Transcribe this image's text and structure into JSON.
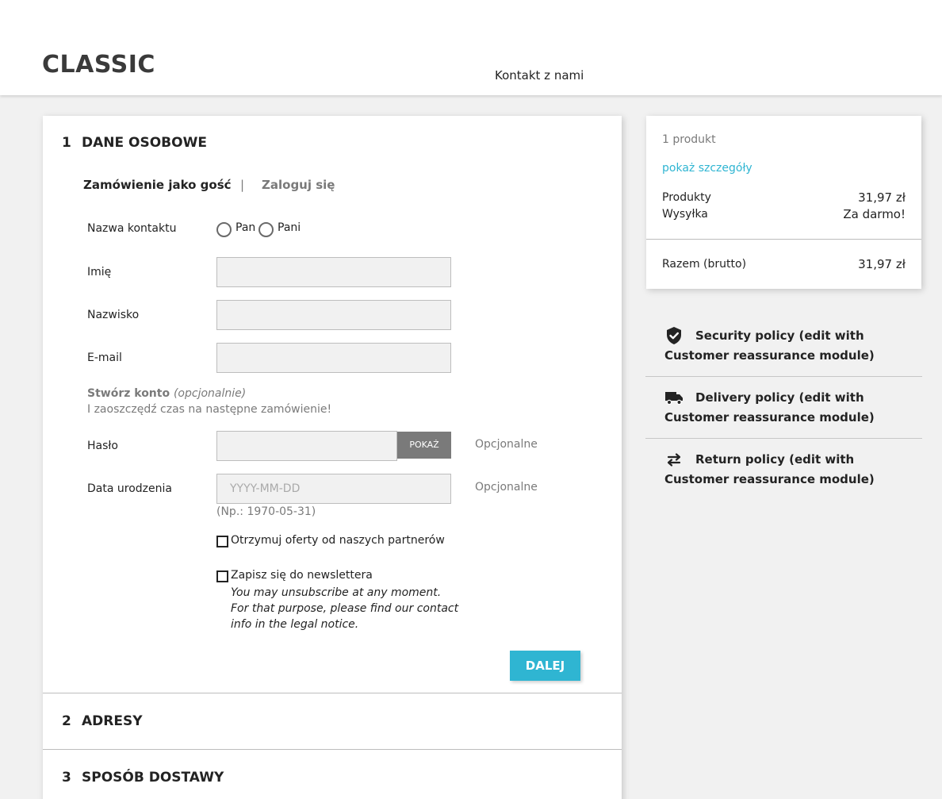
{
  "header": {
    "logo": "CLASSIC",
    "contact_link": "Kontakt z nami"
  },
  "checkout": {
    "steps": [
      {
        "number": "1",
        "title": "DANE OSOBOWE"
      },
      {
        "number": "2",
        "title": "ADRESY"
      },
      {
        "number": "3",
        "title": "SPOSÓB DOSTAWY"
      }
    ],
    "tabs": {
      "guest": "Zamówienie jako gość",
      "separator": "|",
      "login": "Zaloguj się"
    },
    "form": {
      "social_title_label": "Nazwa kontaktu",
      "social_title_options": [
        "Pan",
        "Pani"
      ],
      "firstname_label": "Imię",
      "lastname_label": "Nazwisko",
      "email_label": "E-mail",
      "create_account_title": "Stwórz konto",
      "create_account_optional": "(opcjonalnie)",
      "create_account_subtitle": "I zaoszczędź czas na następne zamówienie!",
      "password_label": "Hasło",
      "show_button": "POKAŻ",
      "optional_text": "Opcjonalne",
      "birthday_label": "Data urodzenia",
      "birthday_placeholder": "YYYY-MM-DD",
      "birthday_hint": "(Np.: 1970-05-31)",
      "partner_offers_label": "Otrzymuj oferty od naszych partnerów",
      "newsletter_label": "Zapisz się do newslettera",
      "newsletter_note": "You may unsubscribe at any moment. For that purpose, please find our contact info in the legal notice.",
      "next_button": "DALEJ"
    }
  },
  "summary": {
    "product_count": "1 produkt",
    "show_details": "pokaż szczegóły",
    "products_label": "Produkty",
    "products_value": "31,97 zł",
    "shipping_label": "Wysyłka",
    "shipping_value": "Za darmo!",
    "total_label": "Razem (brutto)",
    "total_value": "31,97 zł"
  },
  "reassurance": [
    {
      "icon": "shield-check-icon",
      "text": "Security policy (edit with Customer reassurance module)"
    },
    {
      "icon": "truck-icon",
      "text": "Delivery policy (edit with Customer reassurance module)"
    },
    {
      "icon": "exchange-arrows-icon",
      "text": "Return policy (edit with Customer reassurance module)"
    }
  ],
  "colors": {
    "accent": "#2fb5d2",
    "muted": "#7a7a7a",
    "background": "#f1f1f1"
  }
}
